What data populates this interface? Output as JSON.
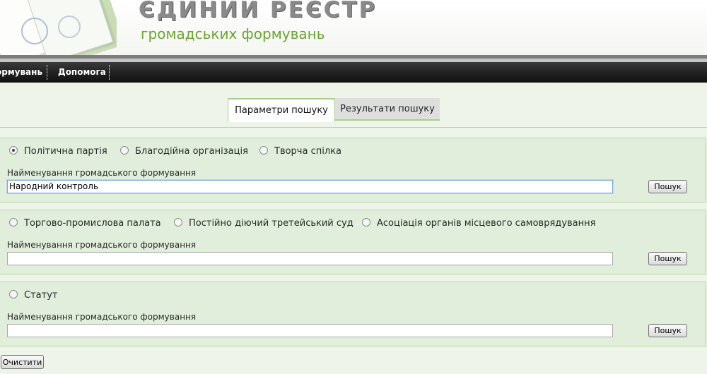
{
  "header": {
    "title": "ЄДИНИЙ  РЕЄСТР",
    "subtitle": "громадських формувань"
  },
  "nav": {
    "items": [
      {
        "label": "ормувань"
      },
      {
        "label": "Допомога"
      }
    ]
  },
  "tabs": [
    {
      "label": "Параметри пошуку",
      "active": true
    },
    {
      "label": "Результати пошуку",
      "active": false
    }
  ],
  "sections": [
    {
      "options": [
        {
          "label": "Політична партія",
          "checked": true
        },
        {
          "label": "Благодійна організація",
          "checked": false
        },
        {
          "label": "Творча спілка",
          "checked": false
        }
      ],
      "field_label": "Найменування громадського формування",
      "value": "Народний контроль",
      "button": "Пошук"
    },
    {
      "options": [
        {
          "label": "Торгово-промислова палата",
          "checked": false
        },
        {
          "label": "Постійно діючий третейський суд",
          "checked": false
        },
        {
          "label": "Асоціація органів місцевого самоврядування",
          "checked": false
        }
      ],
      "field_label": "Найменування громадського формування",
      "value": "",
      "button": "Пошук"
    },
    {
      "options": [
        {
          "label": "Статут",
          "checked": false
        }
      ],
      "field_label": "Найменування громадського формування",
      "value": "",
      "button": "Пошук"
    }
  ],
  "clear_button": "Очистити",
  "colors": {
    "brand_green": "#6aa52e",
    "panel_bg": "#e0eedb",
    "nav_bg": "#222222"
  }
}
